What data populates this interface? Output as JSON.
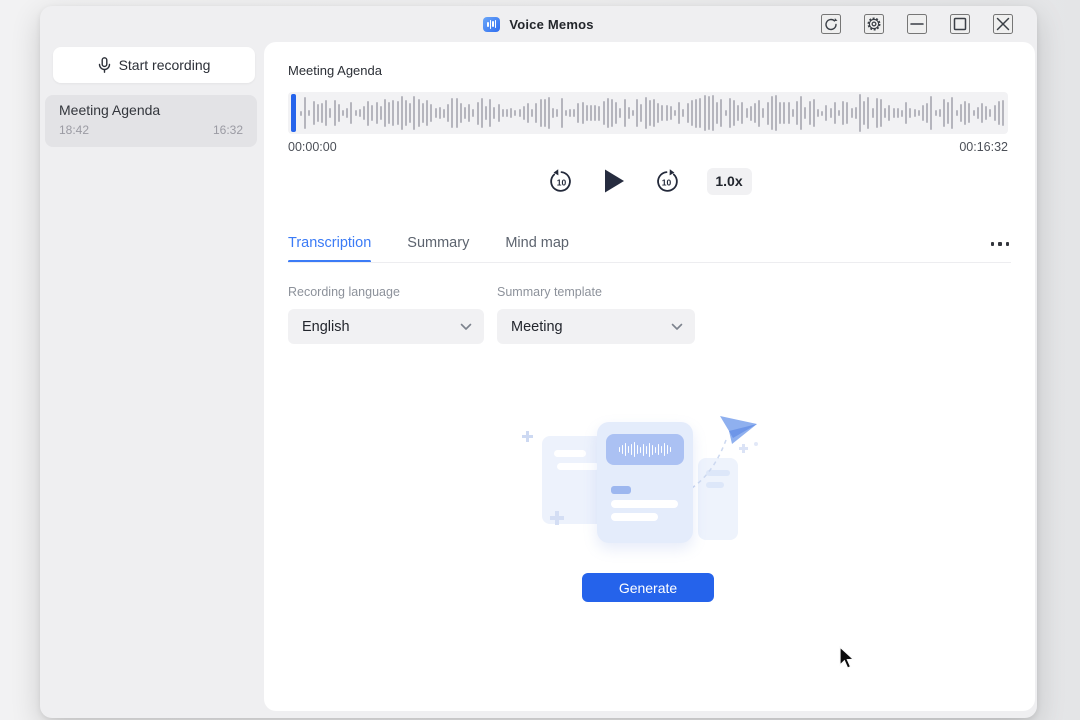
{
  "titlebar": {
    "app_title": "Voice Memos",
    "icons": [
      "refresh-icon",
      "settings-gear-icon",
      "minimize-icon",
      "maximize-icon",
      "close-icon"
    ]
  },
  "sidebar": {
    "start_recording": "Start recording",
    "recordings": [
      {
        "title": "Meeting Agenda",
        "time": "18:42",
        "duration": "16:32",
        "selected": true
      }
    ]
  },
  "player": {
    "recording_title": "Meeting Agenda",
    "elapsed": "00:00:00",
    "total": "00:16:32",
    "skip_amount": "10",
    "speed": "1.0x",
    "state": "paused"
  },
  "tabs": {
    "items": [
      {
        "label": "Transcription",
        "active": true
      },
      {
        "label": "Summary",
        "active": false
      },
      {
        "label": "Mind map",
        "active": false
      }
    ]
  },
  "form": {
    "language_label": "Recording language",
    "language_value": "English",
    "template_label": "Summary template",
    "template_value": "Meeting"
  },
  "actions": {
    "generate": "Generate"
  },
  "colors": {
    "accent_blue": "#2563eb",
    "tab_active_blue": "#3b7bf6",
    "playhead_blue": "#2563eb",
    "waveform_bar": "#b5b5bd",
    "sidebar_selected": "#e3e3e6"
  }
}
